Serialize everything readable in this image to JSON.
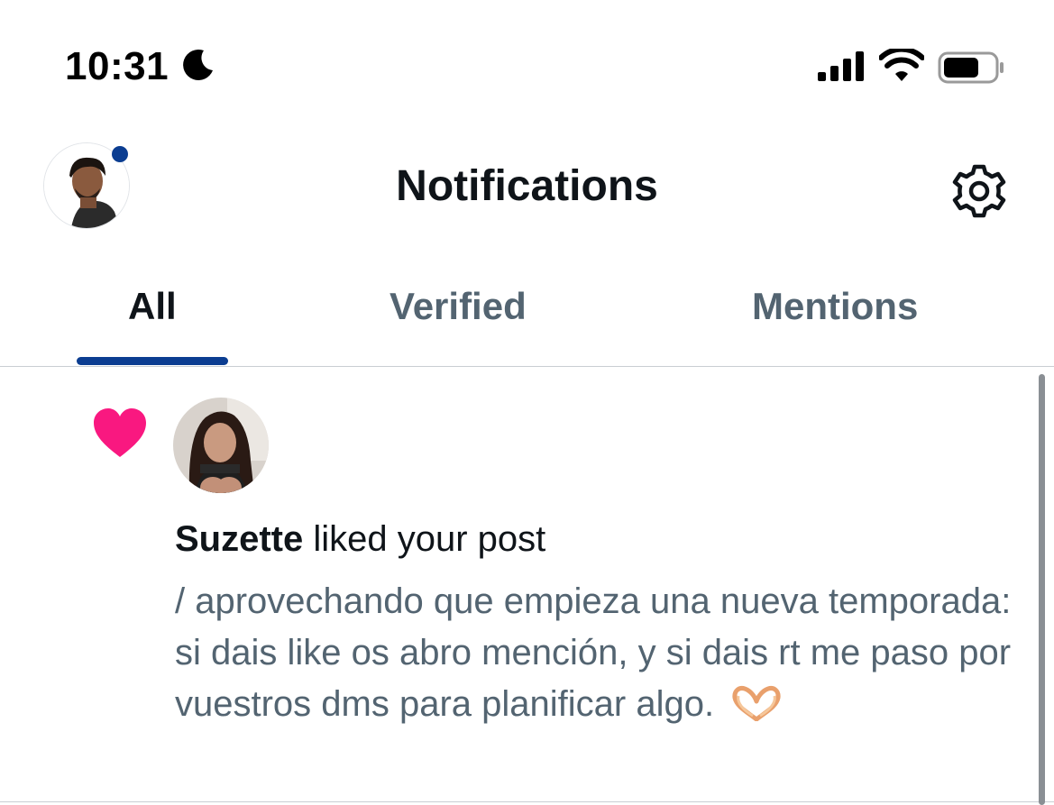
{
  "status_bar": {
    "time": "10:31",
    "focus_mode_icon": "moon-icon",
    "signal_icon": "cellular-signal-icon",
    "wifi_icon": "wifi-icon",
    "battery_icon": "battery-icon"
  },
  "header": {
    "title": "Notifications",
    "avatar_icon": "profile-avatar",
    "settings_icon": "gear-icon",
    "unread_dot_color": "#0b3d91"
  },
  "tabs": [
    {
      "label": "All",
      "active": true
    },
    {
      "label": "Verified",
      "active": false
    },
    {
      "label": "Mentions",
      "active": false
    }
  ],
  "notifications": [
    {
      "type_icon": "heart-icon",
      "type_color": "#f91880",
      "user": "Suzette",
      "action": " liked your post",
      "post_text": "/ aprovechando que empieza una nueva temporada: si dais like os abro mención, y si dais rt me paso por vuestros dms para planificar algo.",
      "emoji": "heart-hands-emoji"
    }
  ],
  "colors": {
    "accent": "#0b3d91",
    "like": "#f91880",
    "secondary_text": "#536471"
  }
}
